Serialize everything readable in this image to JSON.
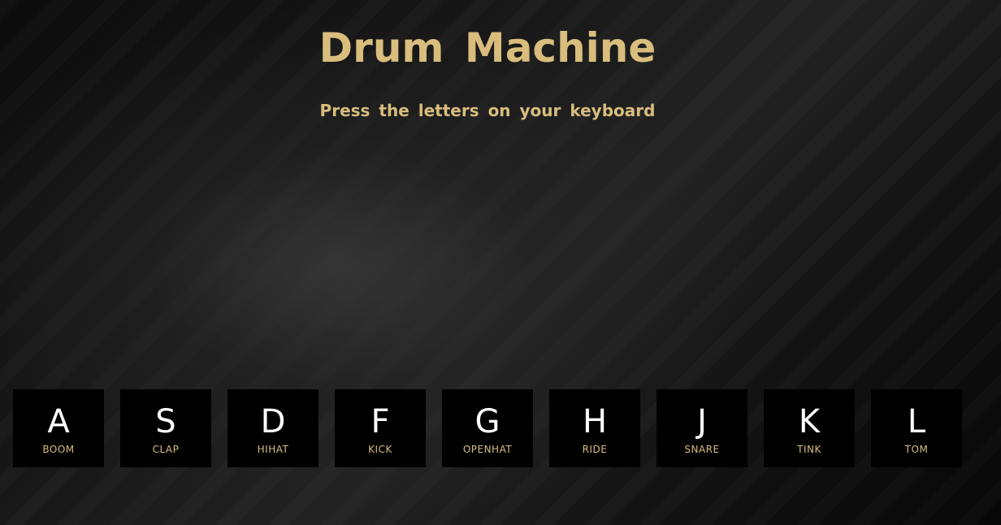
{
  "header": {
    "title": "Drum  Machine",
    "subtitle": "Press  the  letters  on  your  keyboard"
  },
  "keys": [
    {
      "letter": "A",
      "sound": "BOOM"
    },
    {
      "letter": "S",
      "sound": "CLAP"
    },
    {
      "letter": "D",
      "sound": "HIHAT"
    },
    {
      "letter": "F",
      "sound": "KICK"
    },
    {
      "letter": "G",
      "sound": "OPENHAT"
    },
    {
      "letter": "H",
      "sound": "RIDE"
    },
    {
      "letter": "J",
      "sound": "SNARE"
    },
    {
      "letter": "K",
      "sound": "TINK"
    },
    {
      "letter": "L",
      "sound": "TOM"
    }
  ],
  "colors": {
    "accent": "#d9bd7d",
    "key_background": "#000000",
    "key_letter": "#ffffff"
  }
}
